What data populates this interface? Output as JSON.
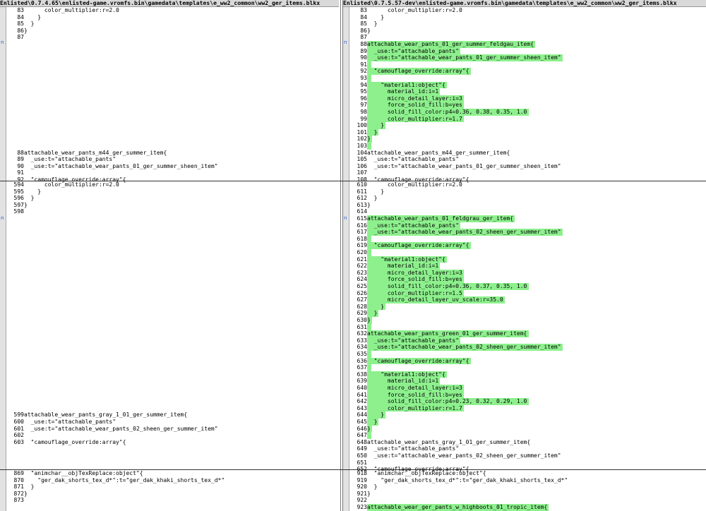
{
  "left_title": "Enlisted\\0.7.4.65\\enlisted-game.vromfs.bin\\gamedata\\templates\\e_ww2_common\\ww2_ger_items.blkx",
  "right_title": "Enlisted\\0.7.5.57-dev\\enlisted-game.vromfs.bin\\gamedata\\templates\\e_ww2_common\\ww2_ger_items.blkx",
  "marker_glyph": "n",
  "highlight_color": "#8df08d",
  "left_blocks": [
    {
      "lines": [
        {
          "n": "83",
          "t": "      color_multiplier:r=2.0"
        },
        {
          "n": "84",
          "t": "    }"
        },
        {
          "n": "85",
          "t": "  }"
        },
        {
          "n": "86",
          "t": "}"
        },
        {
          "n": "87",
          "t": ""
        },
        {
          "n": "",
          "t": ""
        },
        {
          "n": "",
          "t": ""
        },
        {
          "n": "",
          "t": ""
        },
        {
          "n": "",
          "t": ""
        },
        {
          "n": "",
          "t": ""
        },
        {
          "n": "",
          "t": ""
        },
        {
          "n": "",
          "t": ""
        },
        {
          "n": "",
          "t": ""
        },
        {
          "n": "",
          "t": ""
        },
        {
          "n": "",
          "t": ""
        },
        {
          "n": "",
          "t": ""
        },
        {
          "n": "",
          "t": ""
        },
        {
          "n": "",
          "t": ""
        },
        {
          "n": "",
          "t": ""
        },
        {
          "n": "",
          "t": ""
        },
        {
          "n": "",
          "t": ""
        },
        {
          "n": "88",
          "t": "attachable_wear_pants_m44_ger_summer_item{"
        },
        {
          "n": "89",
          "t": "  _use:t=\"attachable_pants\""
        },
        {
          "n": "90",
          "t": "  _use:t=\"attachable_wear_pants_01_ger_summer_sheen_item\""
        },
        {
          "n": "91",
          "t": ""
        },
        {
          "n": "92",
          "t": "  \"camouflage_override:array\"{"
        }
      ]
    },
    {
      "lines": [
        {
          "n": "594",
          "t": "      color_multiplier:r=2.0"
        },
        {
          "n": "595",
          "t": "    }"
        },
        {
          "n": "596",
          "t": "  }"
        },
        {
          "n": "597",
          "t": "}"
        },
        {
          "n": "598",
          "t": ""
        },
        {
          "n": "",
          "t": ""
        },
        {
          "n": "",
          "t": ""
        },
        {
          "n": "",
          "t": ""
        },
        {
          "n": "",
          "t": ""
        },
        {
          "n": "",
          "t": ""
        },
        {
          "n": "",
          "t": ""
        },
        {
          "n": "",
          "t": ""
        },
        {
          "n": "",
          "t": ""
        },
        {
          "n": "",
          "t": ""
        },
        {
          "n": "",
          "t": ""
        },
        {
          "n": "",
          "t": ""
        },
        {
          "n": "",
          "t": ""
        },
        {
          "n": "",
          "t": ""
        },
        {
          "n": "",
          "t": ""
        },
        {
          "n": "",
          "t": ""
        },
        {
          "n": "",
          "t": ""
        },
        {
          "n": "",
          "t": ""
        },
        {
          "n": "",
          "t": ""
        },
        {
          "n": "",
          "t": ""
        },
        {
          "n": "",
          "t": ""
        },
        {
          "n": "",
          "t": ""
        },
        {
          "n": "",
          "t": ""
        },
        {
          "n": "",
          "t": ""
        },
        {
          "n": "",
          "t": ""
        },
        {
          "n": "",
          "t": ""
        },
        {
          "n": "",
          "t": ""
        },
        {
          "n": "",
          "t": ""
        },
        {
          "n": "",
          "t": ""
        },
        {
          "n": "",
          "t": ""
        },
        {
          "n": "599",
          "t": "attachable_wear_pants_gray_1_01_ger_summer_item{"
        },
        {
          "n": "600",
          "t": "  _use:t=\"attachable_pants\""
        },
        {
          "n": "601",
          "t": "  _use:t=\"attachable_wear_pants_02_sheen_ger_summer_item\""
        },
        {
          "n": "602",
          "t": ""
        },
        {
          "n": "603",
          "t": "  \"camouflage_override:array\"{"
        }
      ]
    },
    {
      "lines": [
        {
          "n": "869",
          "t": "  \"animchar__objTexReplace:object\"{"
        },
        {
          "n": "870",
          "t": "    \"ger_dak_shorts_tex_d*\":t=\"ger_dak_khaki_shorts_tex_d*\""
        },
        {
          "n": "871",
          "t": "  }"
        },
        {
          "n": "872",
          "t": "}"
        },
        {
          "n": "873",
          "t": ""
        }
      ]
    }
  ],
  "right_blocks": [
    {
      "lines": [
        {
          "n": "83",
          "t": "      color_multiplier:r=2.0",
          "h": false
        },
        {
          "n": "84",
          "t": "    }",
          "h": false
        },
        {
          "n": "85",
          "t": "  }",
          "h": false
        },
        {
          "n": "86",
          "t": "}",
          "h": false
        },
        {
          "n": "87",
          "t": "",
          "h": false
        },
        {
          "n": "88",
          "t": "attachable_wear_pants_01_ger_summer_feldgau_item{",
          "h": true
        },
        {
          "n": "89",
          "t": "  _use:t=\"attachable_pants\"",
          "h": true
        },
        {
          "n": "90",
          "t": "  _use:t=\"attachable_wear_pants_01_ger_summer_sheen_item\"",
          "h": true
        },
        {
          "n": "91",
          "t": "",
          "h": true
        },
        {
          "n": "92",
          "t": "  \"camouflage_override:array\"{",
          "h": true
        },
        {
          "n": "93",
          "t": "",
          "h": true
        },
        {
          "n": "94",
          "t": "    \"material1:object\"{",
          "h": true
        },
        {
          "n": "95",
          "t": "      material_id:i=1",
          "h": true
        },
        {
          "n": "96",
          "t": "      micro_detail_layer:i=3",
          "h": true
        },
        {
          "n": "97",
          "t": "      force_solid_fill:b=yes",
          "h": true
        },
        {
          "n": "98",
          "t": "      solid_fill_color:p4=0.36, 0.38, 0.35, 1.0",
          "h": true
        },
        {
          "n": "99",
          "t": "      color_multiplier:r=1.7",
          "h": true
        },
        {
          "n": "100",
          "t": "    }",
          "h": true
        },
        {
          "n": "101",
          "t": "  }",
          "h": true
        },
        {
          "n": "102",
          "t": "}",
          "h": true
        },
        {
          "n": "103",
          "t": "",
          "h": true
        },
        {
          "n": "104",
          "t": "attachable_wear_pants_m44_ger_summer_item{",
          "h": false
        },
        {
          "n": "105",
          "t": "  _use:t=\"attachable_pants\"",
          "h": false
        },
        {
          "n": "106",
          "t": "  _use:t=\"attachable_wear_pants_01_ger_summer_sheen_item\"",
          "h": false
        },
        {
          "n": "107",
          "t": "",
          "h": false
        },
        {
          "n": "108",
          "t": "  \"camouflage_override:array\"{",
          "h": false
        }
      ]
    },
    {
      "lines": [
        {
          "n": "610",
          "t": "      color_multiplier:r=2.0",
          "h": false
        },
        {
          "n": "611",
          "t": "    }",
          "h": false
        },
        {
          "n": "612",
          "t": "  }",
          "h": false
        },
        {
          "n": "613",
          "t": "}",
          "h": false
        },
        {
          "n": "614",
          "t": "",
          "h": false
        },
        {
          "n": "615",
          "t": "attachable_wear_pants_01_feldgrau_ger_item{",
          "h": true
        },
        {
          "n": "616",
          "t": "  _use:t=\"attachable_pants\"",
          "h": true
        },
        {
          "n": "617",
          "t": "  _use:t=\"attachable_wear_pants_02_sheen_ger_summer_item\"",
          "h": true
        },
        {
          "n": "618",
          "t": "",
          "h": true
        },
        {
          "n": "619",
          "t": "  \"camouflage_override:array\"{",
          "h": true
        },
        {
          "n": "620",
          "t": "",
          "h": true
        },
        {
          "n": "621",
          "t": "    \"material1:object\"{",
          "h": true
        },
        {
          "n": "622",
          "t": "      material_id:i=1",
          "h": true
        },
        {
          "n": "623",
          "t": "      micro_detail_layer:i=3",
          "h": true
        },
        {
          "n": "624",
          "t": "      force_solid_fill:b=yes",
          "h": true
        },
        {
          "n": "625",
          "t": "      solid_fill_color:p4=0.36, 0.37, 0.35, 1.0",
          "h": true
        },
        {
          "n": "626",
          "t": "      color_multiplier:r=1.5",
          "h": true
        },
        {
          "n": "627",
          "t": "      micro_detail_layer_uv_scale:r=35.0",
          "h": true
        },
        {
          "n": "628",
          "t": "    }",
          "h": true
        },
        {
          "n": "629",
          "t": "  }",
          "h": true
        },
        {
          "n": "630",
          "t": "}",
          "h": true
        },
        {
          "n": "631",
          "t": "",
          "h": true
        },
        {
          "n": "632",
          "t": "attachable_wear_pants_green_01_ger_summer_item{",
          "h": true
        },
        {
          "n": "633",
          "t": "  _use:t=\"attachable_pants\"",
          "h": true
        },
        {
          "n": "634",
          "t": "  _use:t=\"attachable_wear_pants_02_sheen_ger_summer_item\"",
          "h": true
        },
        {
          "n": "635",
          "t": "",
          "h": true
        },
        {
          "n": "636",
          "t": "  \"camouflage_override:array\"{",
          "h": true
        },
        {
          "n": "637",
          "t": "",
          "h": true
        },
        {
          "n": "638",
          "t": "    \"material1:object\"{",
          "h": true
        },
        {
          "n": "639",
          "t": "      material_id:i=1",
          "h": true
        },
        {
          "n": "640",
          "t": "      micro_detail_layer:i=3",
          "h": true
        },
        {
          "n": "641",
          "t": "      force_solid_fill:b=yes",
          "h": true
        },
        {
          "n": "642",
          "t": "      solid_fill_color:p4=0.23, 0.32, 0.29, 1.0",
          "h": true
        },
        {
          "n": "643",
          "t": "      color_multiplier:r=1.7",
          "h": true
        },
        {
          "n": "644",
          "t": "    }",
          "h": true
        },
        {
          "n": "645",
          "t": "  }",
          "h": true
        },
        {
          "n": "646",
          "t": "}",
          "h": true
        },
        {
          "n": "647",
          "t": "",
          "h": true
        },
        {
          "n": "648",
          "t": "attachable_wear_pants_gray_1_01_ger_summer_item{",
          "h": false
        },
        {
          "n": "649",
          "t": "  _use:t=\"attachable_pants\"",
          "h": false
        },
        {
          "n": "650",
          "t": "  _use:t=\"attachable_wear_pants_02_sheen_ger_summer_item\"",
          "h": false
        },
        {
          "n": "651",
          "t": "",
          "h": false
        },
        {
          "n": "652",
          "t": "  \"camouflage_override:array\"{",
          "h": false
        }
      ]
    },
    {
      "lines": [
        {
          "n": "918",
          "t": "  \"animchar__objTexReplace:object\"{",
          "h": false
        },
        {
          "n": "919",
          "t": "    \"ger_dak_shorts_tex_d*\":t=\"ger_dak_khaki_shorts_tex_d*\"",
          "h": false
        },
        {
          "n": "920",
          "t": "  }",
          "h": false
        },
        {
          "n": "921",
          "t": "}",
          "h": false
        },
        {
          "n": "922",
          "t": "",
          "h": false
        },
        {
          "n": "923",
          "t": "attachable_wear_ger_pants_w_highboots_01_tropic_item{",
          "h": true
        }
      ]
    }
  ]
}
